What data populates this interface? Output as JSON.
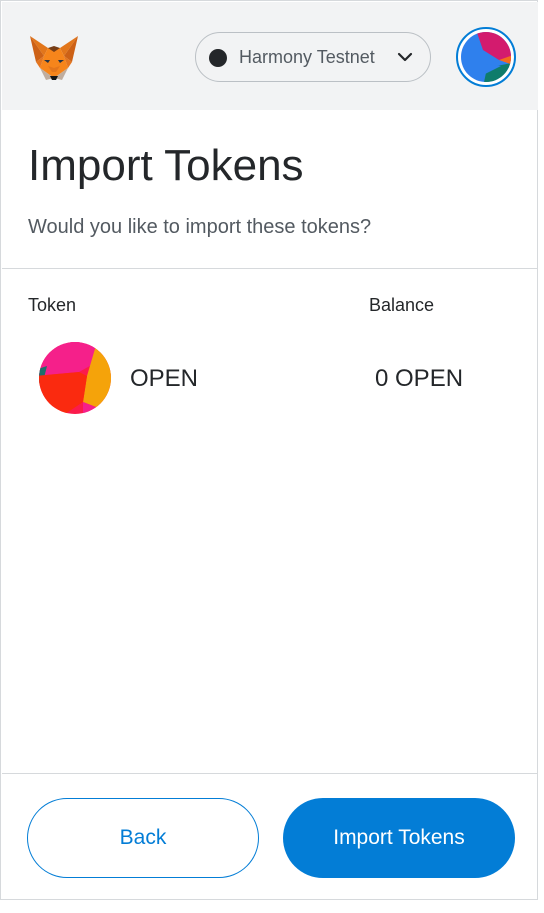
{
  "header": {
    "logo_icon": "metamask-fox-icon",
    "network": {
      "label": "Harmony Testnet",
      "status_color": "#24272a",
      "caret_icon": "chevron-down-icon"
    },
    "account_avatar_icon": "jazzicon-avatar"
  },
  "page": {
    "title": "Import Tokens",
    "subtitle": "Would you like to import these tokens?"
  },
  "table": {
    "columns": [
      "Token",
      "Balance"
    ],
    "rows": [
      {
        "icon": "token-jazzicon",
        "symbol": "OPEN",
        "balance": "0 OPEN"
      }
    ]
  },
  "footer": {
    "back_label": "Back",
    "import_label": "Import Tokens"
  },
  "colors": {
    "primary": "#037dd6",
    "header_bg": "#f2f3f4",
    "text": "#24272a",
    "muted_text": "#535a61"
  }
}
